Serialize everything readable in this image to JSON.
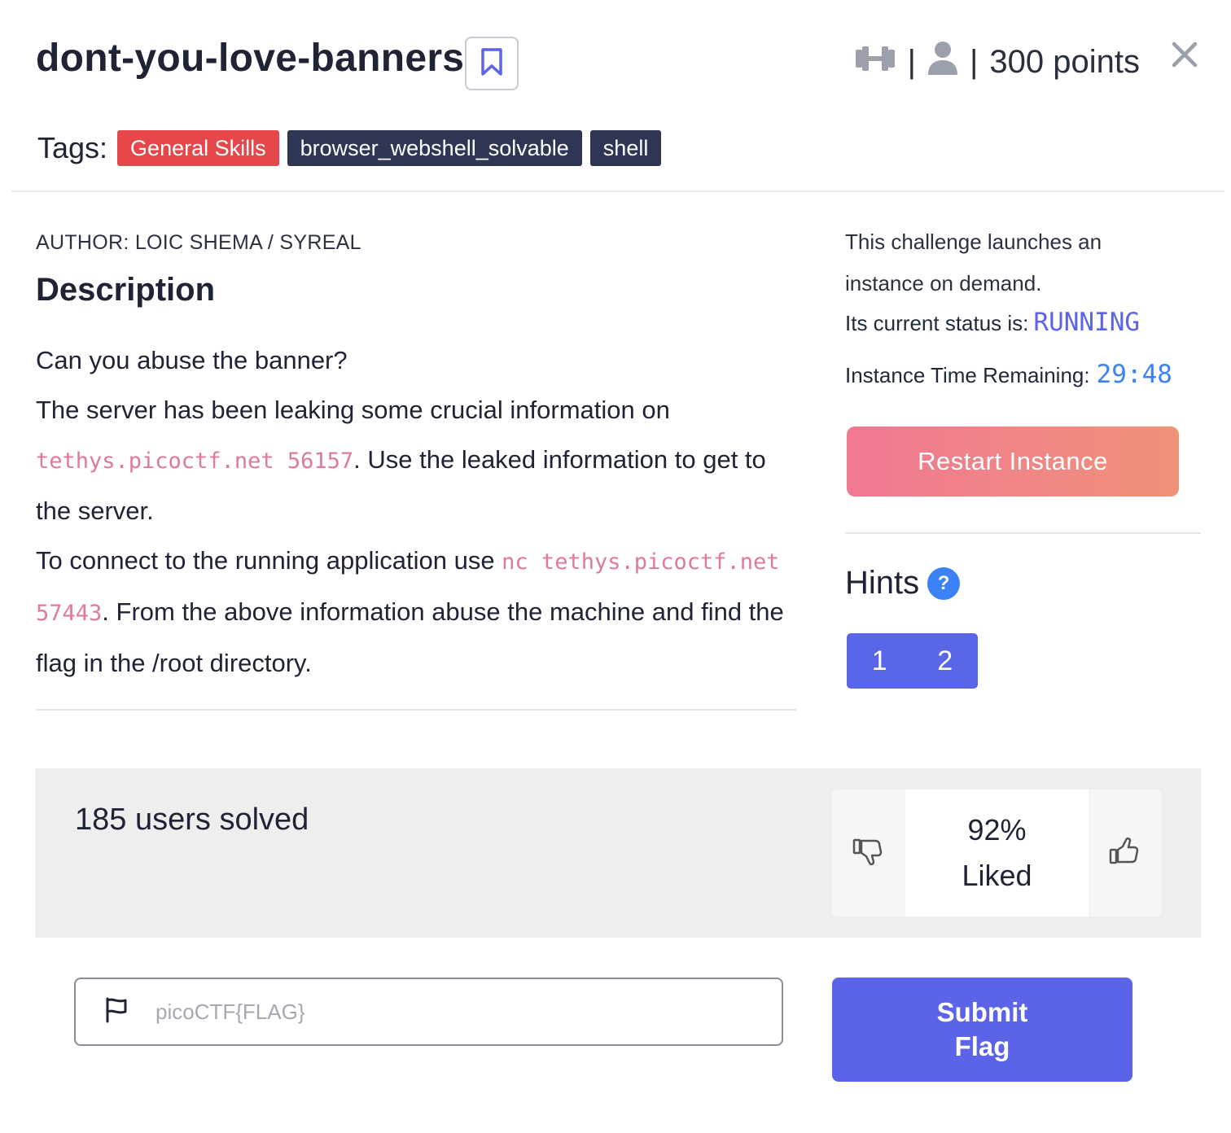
{
  "challenge": {
    "title": "dont-you-love-banners",
    "points": "300 points",
    "separator": "|"
  },
  "tags": {
    "label": "Tags:",
    "items": [
      {
        "label": "General Skills",
        "color": "#e5474b"
      },
      {
        "label": "browser_webshell_solvable",
        "color": "#2e3654"
      },
      {
        "label": "shell",
        "color": "#2e3654"
      }
    ]
  },
  "author": "AUTHOR: LOIC SHEMA / SYREAL",
  "description": {
    "heading": "Description",
    "line1": "Can you abuse the banner?",
    "line2_pre": "The server has been leaking some crucial information on ",
    "line2_code": "tethys.picoctf.net 56157",
    "line2_post": ". Use the leaked information to get to the server.",
    "line3_pre": "To connect to the running application use ",
    "line3_code": "nc tethys.picoctf.net 57443",
    "line3_post": ". From the above information abuse the machine and find the flag in the /root directory."
  },
  "instance": {
    "info": "This challenge launches an instance on demand.",
    "status_label": "Its current status is:",
    "status_value": "RUNNING",
    "time_label": "Instance Time Remaining:",
    "time_value": "29:48",
    "restart_label": "Restart Instance"
  },
  "hints": {
    "heading": "Hints",
    "help_symbol": "?",
    "buttons": [
      "1",
      "2"
    ]
  },
  "stats": {
    "solved": "185 users solved",
    "liked_percent": "92%",
    "liked_label": "Liked"
  },
  "flag_form": {
    "placeholder": "picoCTF{FLAG}",
    "submit_line1": "Submit",
    "submit_line2": "Flag"
  },
  "icons": {
    "bookmark": "bookmark-icon",
    "difficulty": "dumbbell-icon",
    "user": "user-icon",
    "close": "close-icon",
    "thumbs_down": "thumbs-down-icon",
    "thumbs_up": "thumbs-up-icon",
    "flag": "flag-icon"
  },
  "colors": {
    "accent": "#5b63e8",
    "tag_red": "#e5474b",
    "tag_dark": "#2e3654",
    "code": "#e07a9a",
    "restart_gradient_start": "#f07893",
    "restart_gradient_end": "#f0927a"
  }
}
